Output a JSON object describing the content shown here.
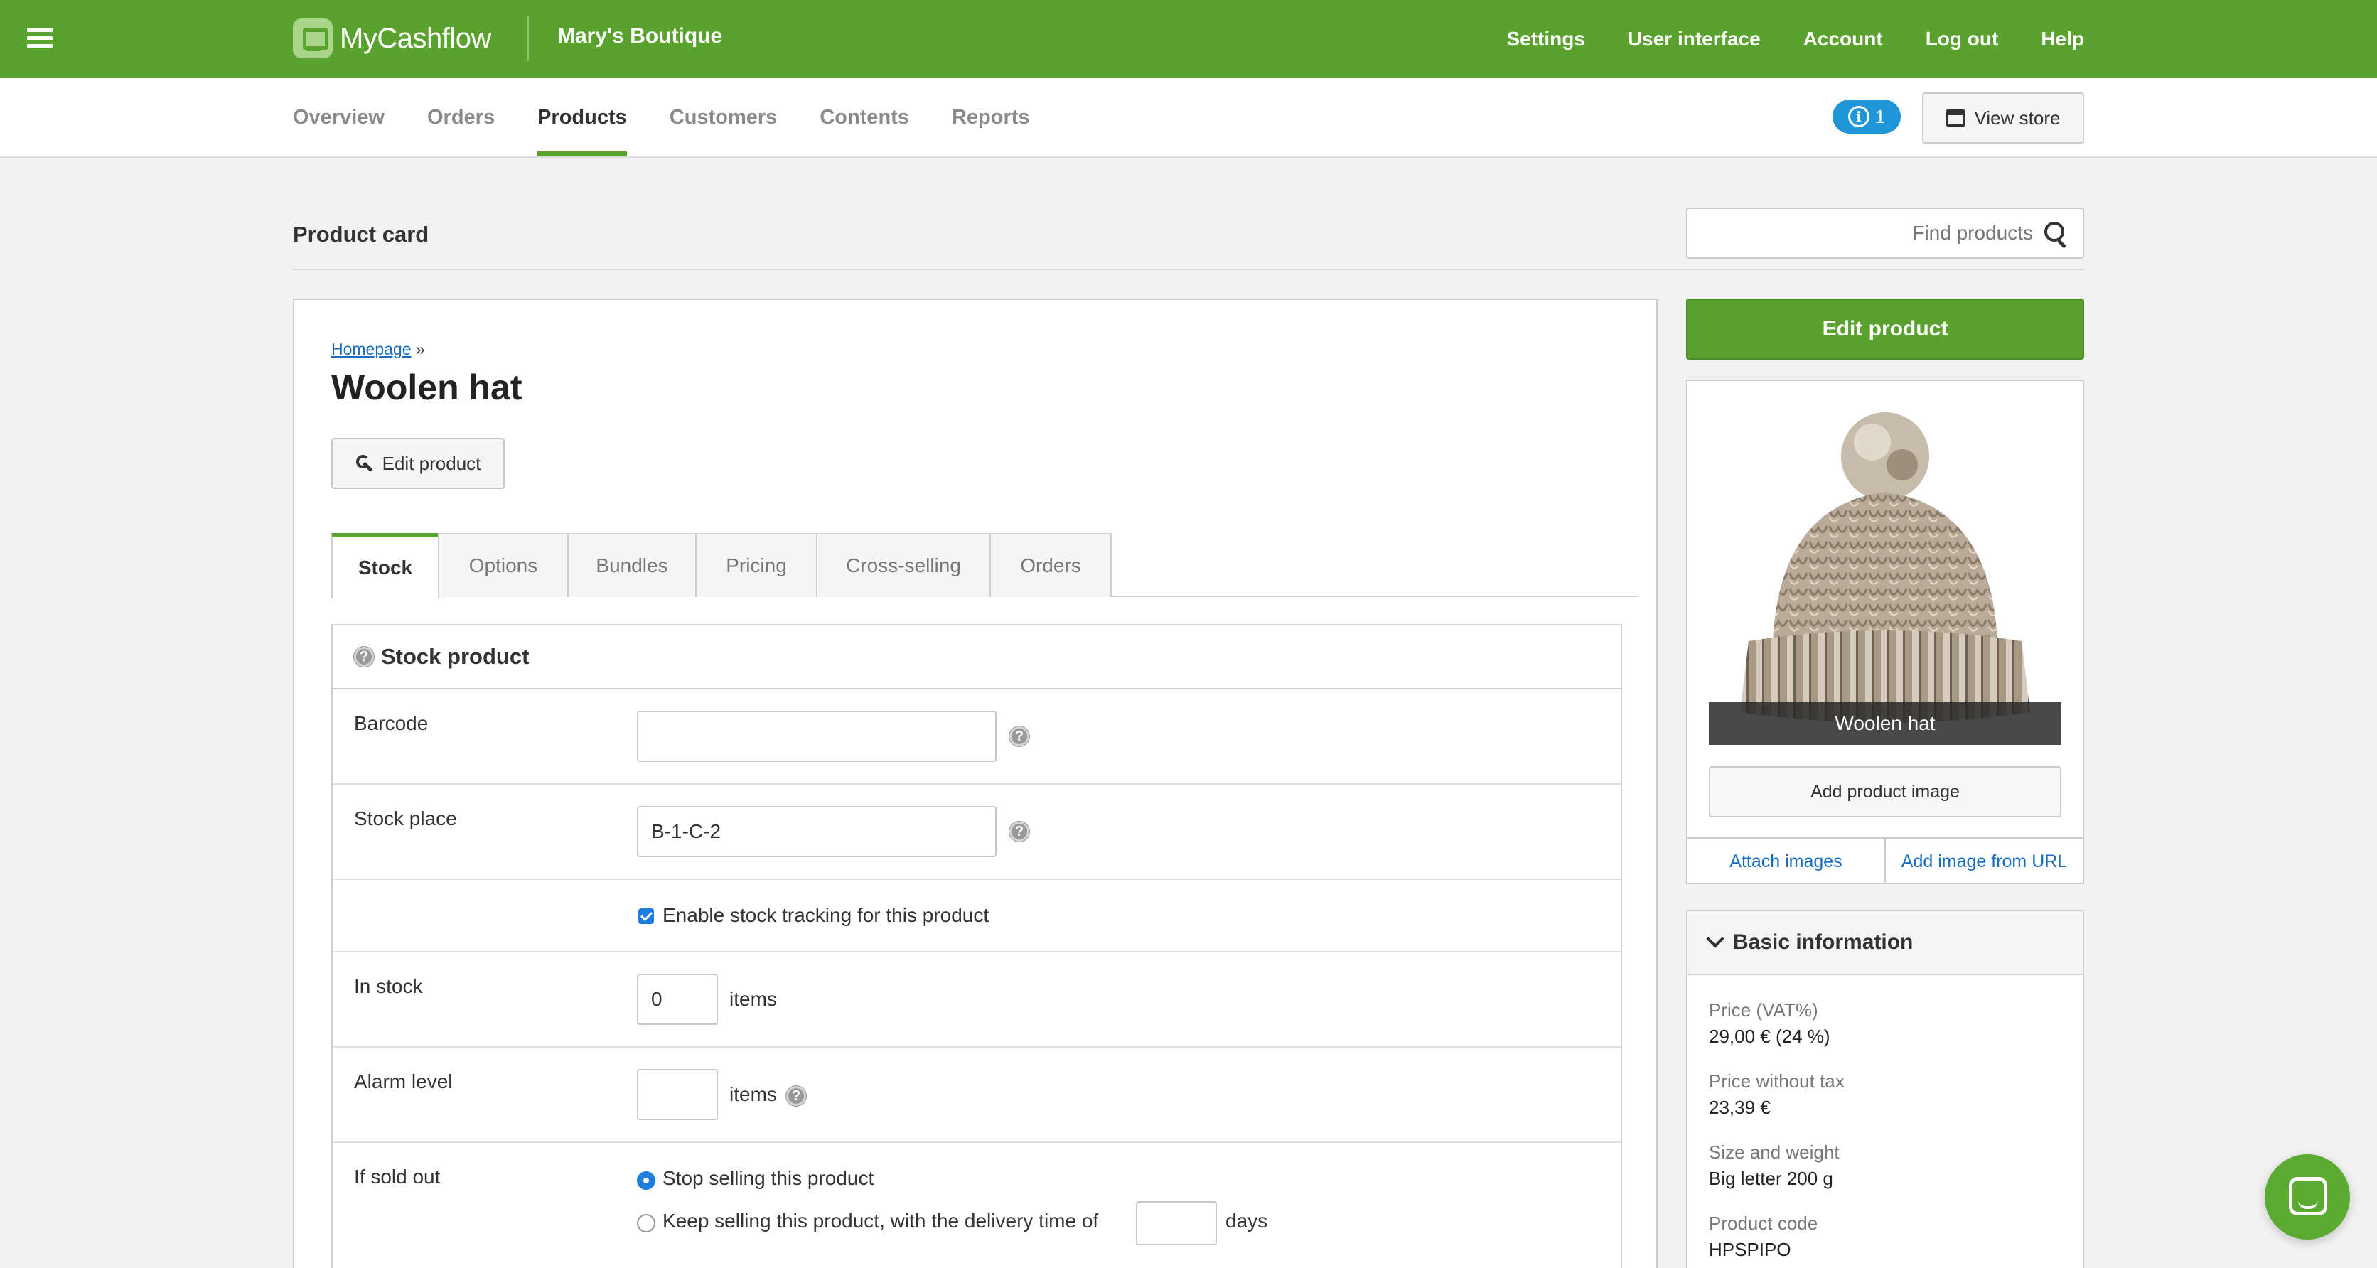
{
  "topbar": {
    "brand": "MyCashflow",
    "store_name": "Mary's Boutique",
    "links": [
      "Settings",
      "User interface",
      "Account",
      "Log out",
      "Help"
    ]
  },
  "main_nav": {
    "tabs": [
      "Overview",
      "Orders",
      "Products",
      "Customers",
      "Contents",
      "Reports"
    ],
    "active": "Products",
    "notification_count": "1",
    "view_store": "View store"
  },
  "page": {
    "title": "Product card",
    "search_placeholder": "Find products"
  },
  "product": {
    "breadcrumb_link": "Homepage",
    "breadcrumb_sep": "»",
    "name": "Woolen hat",
    "edit_label": "Edit product"
  },
  "subtabs": [
    "Stock",
    "Options",
    "Bundles",
    "Pricing",
    "Cross-selling",
    "Orders"
  ],
  "stock": {
    "heading": "Stock product",
    "barcode_label": "Barcode",
    "barcode_value": "",
    "stock_place_label": "Stock place",
    "stock_place_value": "B-1-C-2",
    "tracking_label": "Enable stock tracking for this product",
    "tracking_checked": true,
    "in_stock_label": "In stock",
    "in_stock_value": "0",
    "items_unit": "items",
    "alarm_label": "Alarm level",
    "alarm_value": "",
    "sold_out_label": "If sold out",
    "sold_out_option1": "Stop selling this product",
    "sold_out_option2": "Keep selling this product, with the delivery time of",
    "delivery_days_value": "",
    "days_unit": "days"
  },
  "sidebar": {
    "edit_button": "Edit product",
    "image_caption": "Woolen hat",
    "add_image": "Add product image",
    "attach_images": "Attach images",
    "add_from_url": "Add image from URL",
    "basic_heading": "Basic information",
    "info": [
      {
        "label": "Price (VAT%)",
        "value": "29,00 € (24 %)"
      },
      {
        "label": "Price without tax",
        "value": "23,39 €"
      },
      {
        "label": "Size and weight",
        "value": "Big letter 200 g"
      },
      {
        "label": "Product code",
        "value": "HPSPIPO"
      }
    ]
  },
  "colors": {
    "brand_green": "#58a22d",
    "link_blue": "#1a6ebf",
    "notification_blue": "#1e96d8"
  }
}
